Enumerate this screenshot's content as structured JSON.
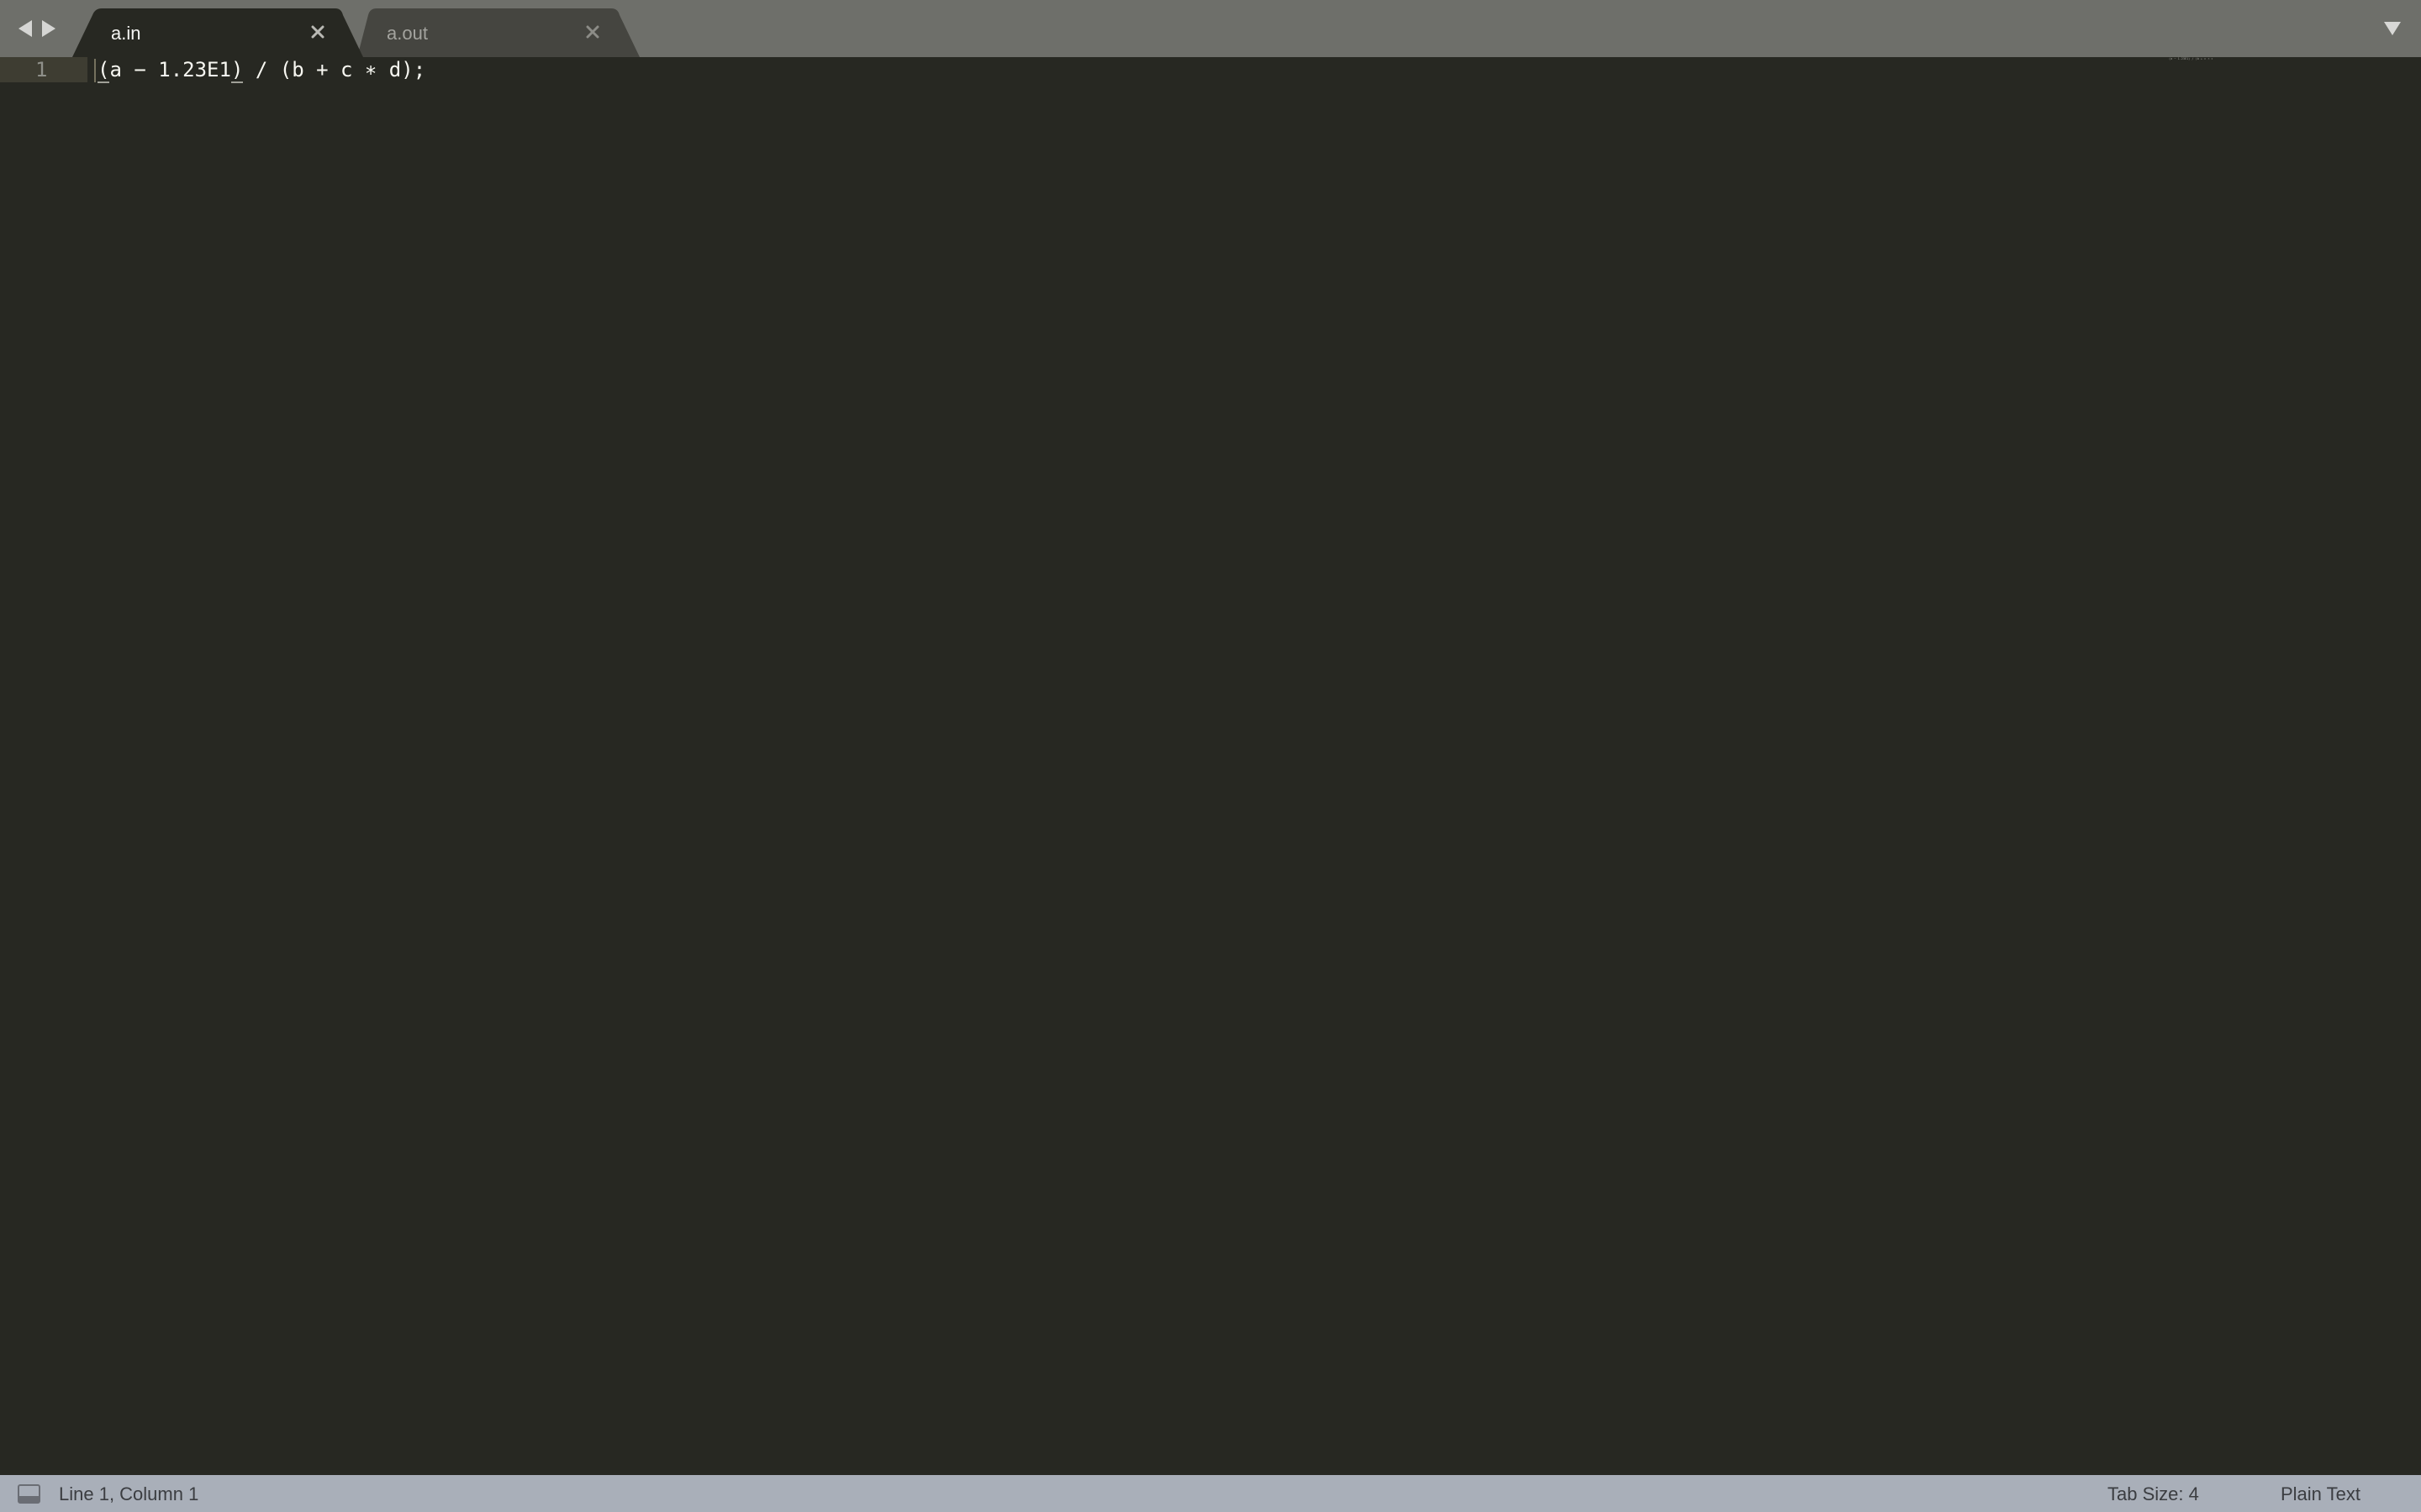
{
  "window": {
    "theme_colors": {
      "tabbar_bg": "#6e6f6a",
      "active_tab_bg": "#272822",
      "inactive_tab_bg": "#454540",
      "editor_bg": "#272822",
      "line_highlight": "#3e3d32",
      "statusbar_bg": "#a9afb9"
    }
  },
  "tabbar": {
    "back_icon": "triangle-left",
    "forward_icon": "triangle-right",
    "tabs": [
      {
        "label": "a.in",
        "active": true,
        "close_icon": "×"
      },
      {
        "label": "a.out",
        "active": false,
        "close_icon": "×"
      }
    ],
    "dropdown_icon": "triangle-down"
  },
  "editor": {
    "lines": [
      {
        "number": "1",
        "segments": [
          {
            "text": "(",
            "bracket_match": true
          },
          {
            "text": "a − 1.23E1",
            "bracket_match": false
          },
          {
            "text": ")",
            "bracket_match": true
          },
          {
            "text": " / (b + c ∗ d);",
            "bracket_match": false
          }
        ]
      }
    ],
    "minimap_text": "(a − 1.23E1) / (b + c ∗ d);"
  },
  "statusbar": {
    "panel_icon": "panel-toggle",
    "position": "Line 1, Column 1",
    "tab_size": "Tab Size: 4",
    "syntax": "Plain Text"
  }
}
